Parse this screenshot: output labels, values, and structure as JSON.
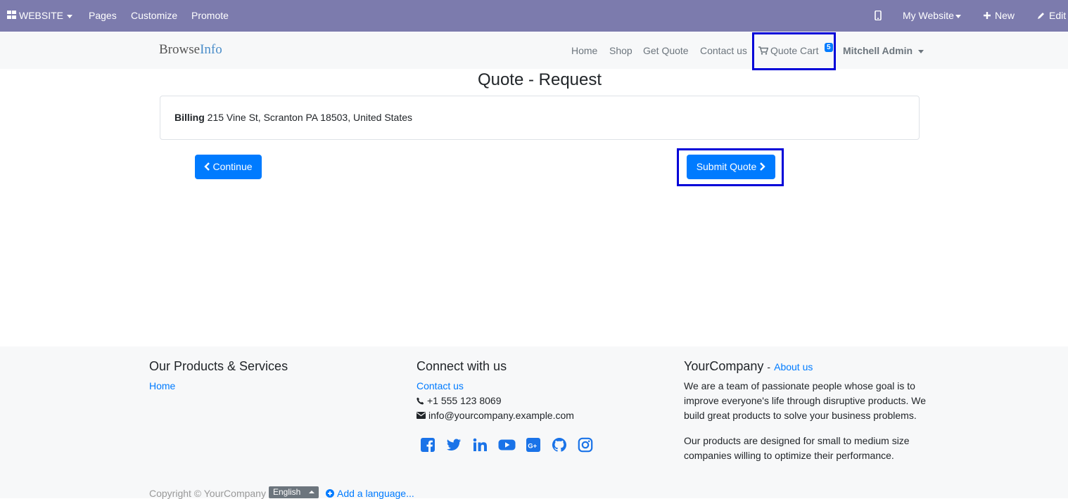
{
  "adminbar": {
    "website": "WEBSITE",
    "pages": "Pages",
    "customize": "Customize",
    "promote": "Promote",
    "my_website": "My Website",
    "new": "New",
    "edit": "Edit"
  },
  "header": {
    "logo_part1": "Browse",
    "logo_part2": "Info",
    "nav": [
      "Home",
      "Shop",
      "Get Quote",
      "Contact us"
    ],
    "quote_cart": "Quote Cart",
    "cart_count": "5",
    "user": "Mitchell Admin"
  },
  "main": {
    "title": "Quote - Request",
    "billing_label": "Billing",
    "billing_address": "215 Vine St, Scranton PA 18503, United States",
    "continue": "Continue",
    "submit": "Submit Quote"
  },
  "footer": {
    "products_heading": "Our Products & Services",
    "products_home": "Home",
    "connect_heading": "Connect with us",
    "contact_link": "Contact us",
    "phone": "+1 555 123 8069",
    "email": "info@yourcompany.example.com",
    "company": "YourCompany",
    "about_dash": "-",
    "about_link": "About us",
    "about_p1": "We are a team of passionate people whose goal is to improve everyone's life through disruptive products. We build great products to solve your business problems.",
    "about_p2": "Our products are designed for small to medium size companies willing to optimize their performance.",
    "copyright": "Copyright © YourCompany",
    "language": "English",
    "add_language": "Add a language...",
    "social_icons": [
      "facebook-icon",
      "twitter-icon",
      "linkedin-icon",
      "youtube-icon",
      "google-plus-icon",
      "github-icon",
      "instagram-icon"
    ]
  },
  "colors": {
    "adminbar": "#7c7bad",
    "primary": "#007bff",
    "highlight": "#0000d8"
  }
}
